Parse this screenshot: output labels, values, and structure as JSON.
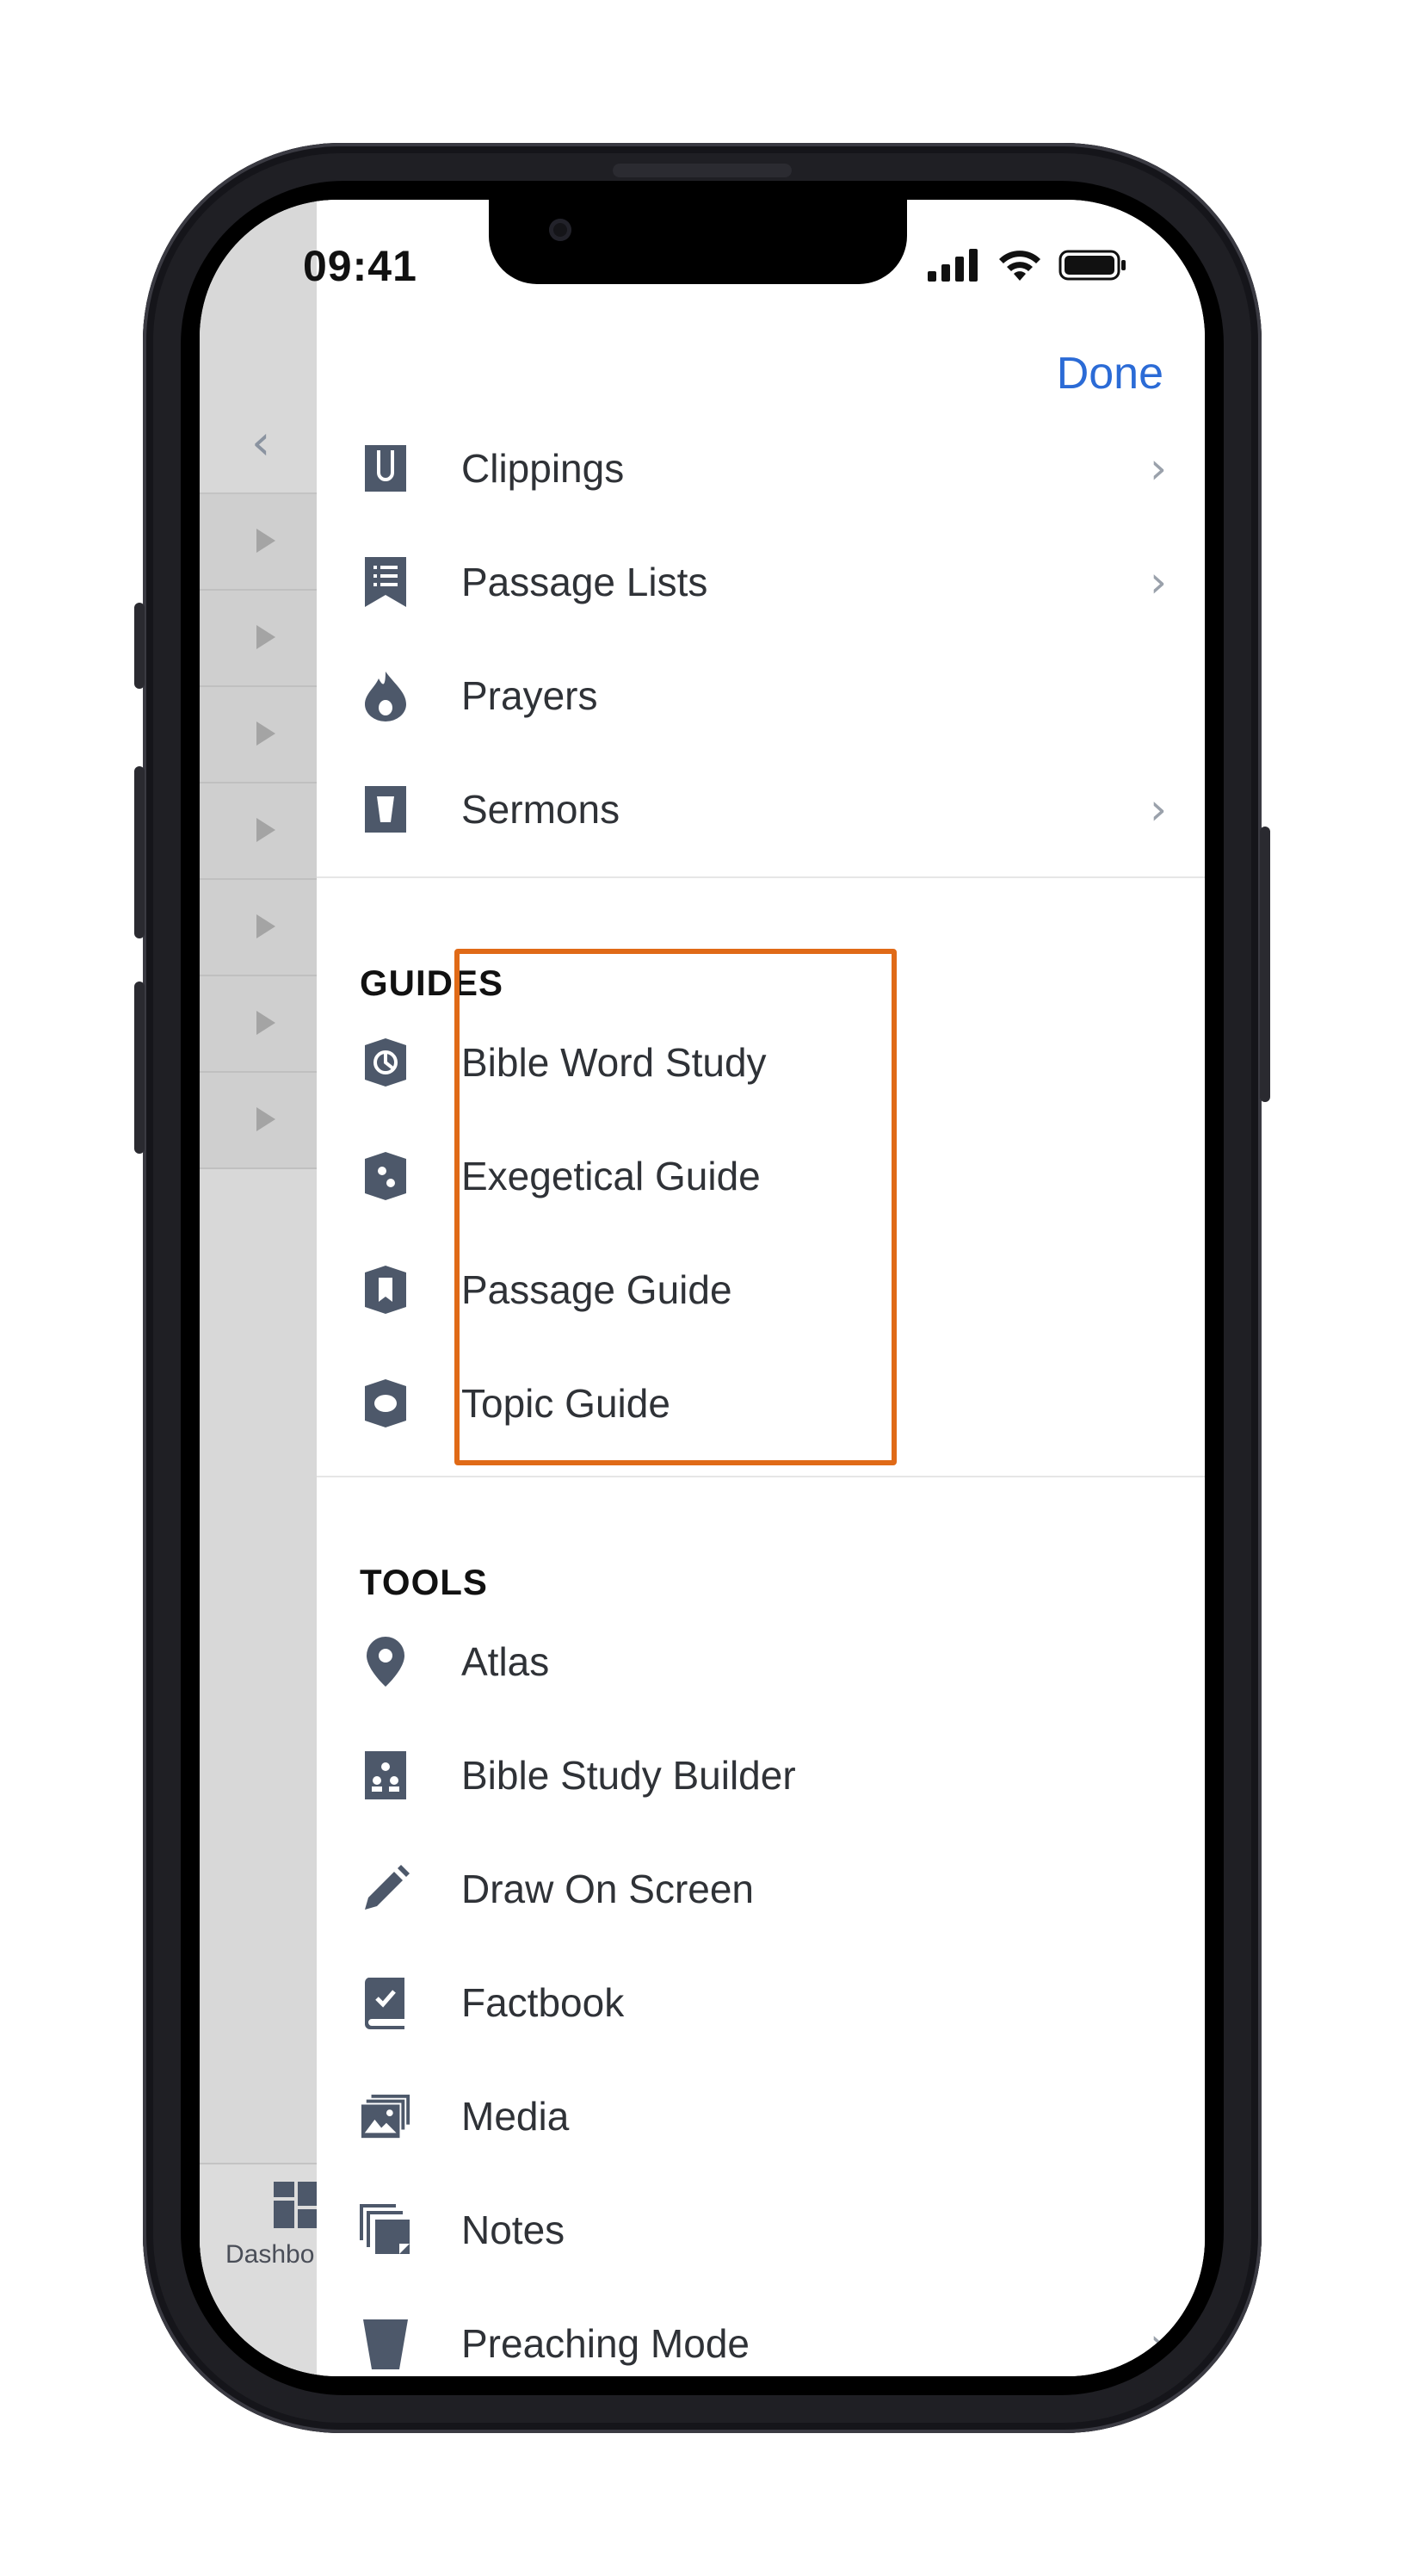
{
  "status": {
    "time": "09:41"
  },
  "header": {
    "done_label": "Done"
  },
  "top_items": [
    {
      "label": "Clippings",
      "icon": "clipping-icon",
      "chevron": true
    },
    {
      "label": "Passage Lists",
      "icon": "passage-list-icon",
      "chevron": true
    },
    {
      "label": "Prayers",
      "icon": "prayer-flame-icon",
      "chevron": false
    },
    {
      "label": "Sermons",
      "icon": "sermon-icon",
      "chevron": true
    }
  ],
  "guides": {
    "title": "GUIDES",
    "items": [
      {
        "label": "Bible Word Study",
        "icon": "word-study-icon"
      },
      {
        "label": "Exegetical Guide",
        "icon": "exegetical-guide-icon"
      },
      {
        "label": "Passage Guide",
        "icon": "passage-guide-icon"
      },
      {
        "label": "Topic Guide",
        "icon": "topic-guide-icon"
      }
    ]
  },
  "tools": {
    "title": "TOOLS",
    "items": [
      {
        "label": "Atlas",
        "icon": "map-pin-icon"
      },
      {
        "label": "Bible Study Builder",
        "icon": "study-builder-icon"
      },
      {
        "label": "Draw On Screen",
        "icon": "pencil-icon"
      },
      {
        "label": "Factbook",
        "icon": "factbook-icon"
      },
      {
        "label": "Media",
        "icon": "media-icon"
      },
      {
        "label": "Notes",
        "icon": "notes-icon"
      },
      {
        "label": "Preaching Mode",
        "icon": "preaching-mode-icon"
      }
    ]
  },
  "underlying": {
    "dashboard_label": "Dashbo"
  },
  "colors": {
    "accent": "#2b6bd6",
    "highlight": "#e06a17",
    "icon": "#4d586a"
  }
}
